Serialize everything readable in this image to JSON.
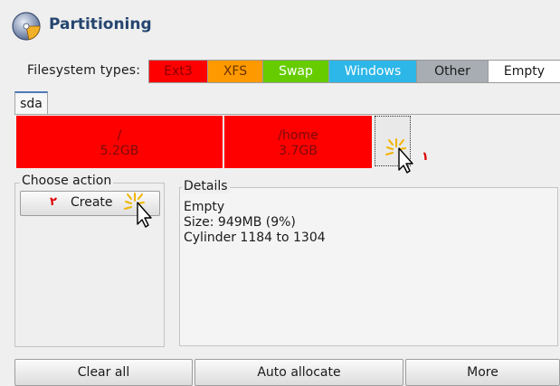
{
  "window": {
    "title": "Partitioning"
  },
  "filesystem_types": {
    "label": "Filesystem types:",
    "items": [
      {
        "label": "Ext3",
        "color": "#ff0000",
        "text_color": "#8a0000"
      },
      {
        "label": "XFS",
        "color": "#ff9900",
        "text_color": "#6a3300"
      },
      {
        "label": "Swap",
        "color": "#66cc00",
        "text_color": "#ffffff"
      },
      {
        "label": "Windows",
        "color": "#2db7e8",
        "text_color": "#ffffff"
      },
      {
        "label": "Other",
        "color": "#a7adb3",
        "text_color": "#1a1a1a"
      },
      {
        "label": "Empty",
        "color": "#ffffff",
        "text_color": "#1a1a1a"
      }
    ]
  },
  "disk": {
    "tab_label": "sda",
    "partitions": [
      {
        "mount": "/",
        "size": "5.2GB",
        "color": "#ff0000"
      },
      {
        "mount": "/home",
        "size": "3.7GB",
        "color": "#ff0000"
      }
    ],
    "empty_marker": "١"
  },
  "choose_action": {
    "title": "Choose action",
    "create_label": "Create",
    "create_marker": "٢"
  },
  "details": {
    "title": "Details",
    "lines": [
      "Empty",
      "Size: 949MB (9%)",
      "Cylinder 1184 to 1304"
    ]
  },
  "bottom_buttons": {
    "clear_all": "Clear all",
    "auto_allocate": "Auto allocate",
    "more": "More"
  },
  "icons": {
    "title": "partition-disk-icon",
    "cursor": "hand-pointer-click-icon"
  }
}
